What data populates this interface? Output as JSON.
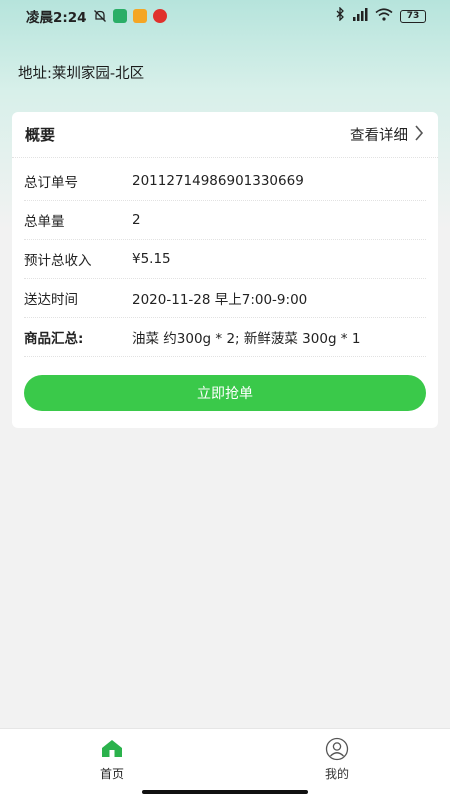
{
  "status_bar": {
    "time": "凌晨2:24",
    "battery": "73"
  },
  "address": {
    "text": "地址:莱圳家园-北区"
  },
  "summary_card": {
    "title": "概要",
    "detail_link": "查看详细",
    "rows": [
      {
        "label": "总订单号",
        "value": "20112714986901330669"
      },
      {
        "label": "总单量",
        "value": "2"
      },
      {
        "label": "预计总收入",
        "value": "¥5.15"
      },
      {
        "label": "送达时间",
        "value": "2020-11-28 早上7:00-9:00"
      },
      {
        "label": "商品汇总:",
        "value": "油菜 约300g * 2; 新鲜菠菜 300g * 1"
      }
    ],
    "grab_button": "立即抢单"
  },
  "tabbar": {
    "home": "首页",
    "mine": "我的"
  },
  "colors": {
    "accent_green": "#3ac94a",
    "tab_active_green": "#2bb24c"
  },
  "icons": [
    "silent-bell-icon",
    "wechat-icon",
    "message-icon",
    "netease-music-icon",
    "bluetooth-icon",
    "signal-icon",
    "wifi-icon",
    "battery-icon",
    "chevron-right-icon",
    "home-icon",
    "user-icon"
  ]
}
